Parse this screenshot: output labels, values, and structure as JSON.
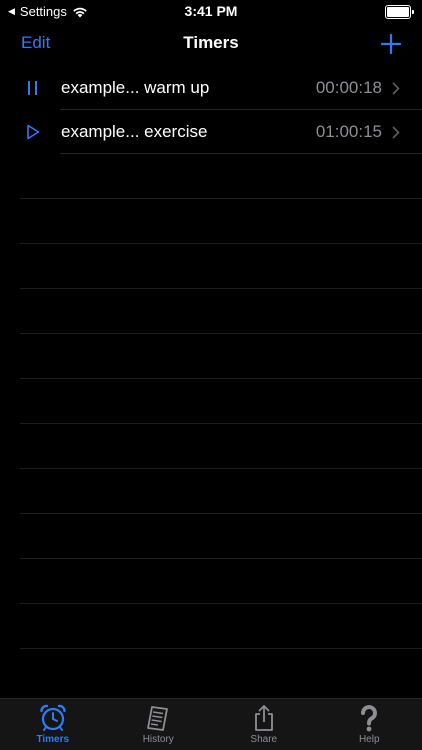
{
  "status_bar": {
    "back_app": "Settings",
    "time": "3:41 PM"
  },
  "nav": {
    "edit_label": "Edit",
    "title": "Timers"
  },
  "timers": [
    {
      "label": "example... warm up",
      "time": "00:00:18",
      "state": "running"
    },
    {
      "label": "example... exercise",
      "time": "01:00:15",
      "state": "stopped"
    }
  ],
  "tabs": [
    {
      "label": "Timers",
      "icon": "alarm-clock-icon",
      "active": true
    },
    {
      "label": "History",
      "icon": "history-scroll-icon",
      "active": false
    },
    {
      "label": "Share",
      "icon": "share-icon",
      "active": false
    },
    {
      "label": "Help",
      "icon": "question-mark-icon",
      "active": false
    }
  ],
  "colors": {
    "accent": "#2f7bf6",
    "background": "#000000",
    "secondary_text": "#8e8e93"
  }
}
